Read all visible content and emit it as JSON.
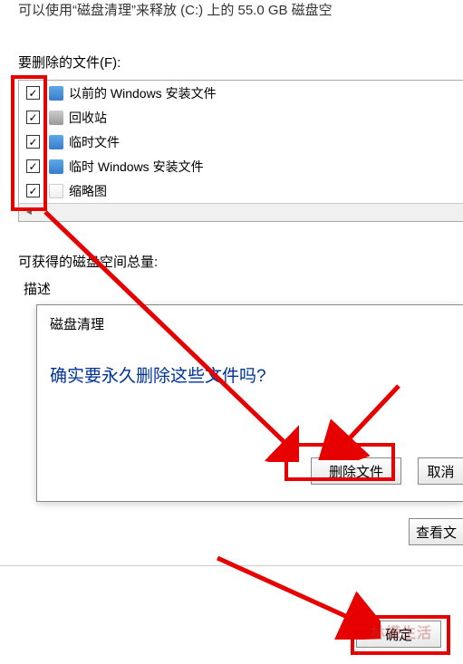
{
  "top_partial_text": "可以使用“磁盘清理”来释放 (C:) 上的 55.0 GB 磁盘空",
  "files_to_delete_label": "要删除的文件(F):",
  "file_items": [
    {
      "checked": true,
      "label": "以前的 Windows 安装文件",
      "icon": "folder"
    },
    {
      "checked": true,
      "label": "回收站",
      "icon": "bin"
    },
    {
      "checked": true,
      "label": "临时文件",
      "icon": "folder"
    },
    {
      "checked": true,
      "label": "临时 Windows 安装文件",
      "icon": "folder"
    },
    {
      "checked": true,
      "label": "缩略图",
      "icon": "file"
    }
  ],
  "space_total_label": "可获得的磁盘空间总量:",
  "description_label": "描述",
  "dialog": {
    "title": "磁盘清理",
    "question": "确实要永久删除这些文件吗?",
    "delete_btn": "删除文件",
    "cancel_btn": "取消"
  },
  "view_files_btn": "查看文",
  "ok_btn": "确定",
  "watermark": "林檬生活"
}
